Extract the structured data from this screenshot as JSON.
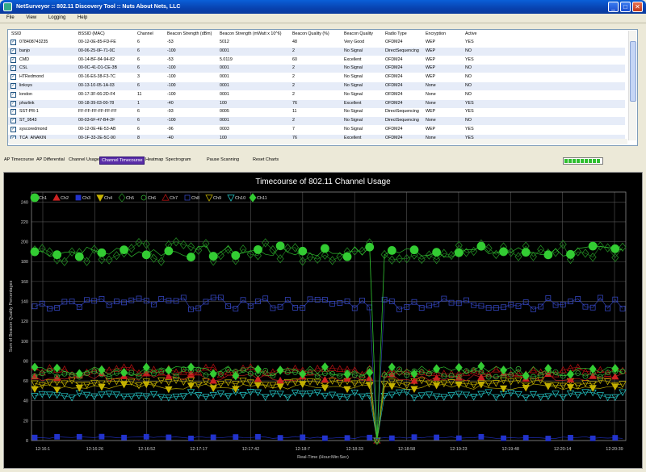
{
  "window": {
    "title": "NetSurveyor :: 802.11 Discovery Tool :: Nuts About Nets, LLC",
    "minimize": "_",
    "maximize": "□",
    "close": "✕"
  },
  "menu": [
    "File",
    "View",
    "Logging",
    "Help"
  ],
  "table": {
    "columns": [
      "SSID",
      "BSSID (MAC)",
      "Channel",
      "Beacon Strength (dBm)",
      "Beacon Strength (mWatt x 10^6)",
      "Beacon Quality (%)",
      "Beacon Quality",
      "Radio Type",
      "Encryption",
      "Active"
    ],
    "rows": [
      {
        "checked": true,
        "cells": [
          "078408743235",
          "00-12-0E-85-FD-FE",
          "6",
          "-53",
          "5012",
          "48",
          "Very Good",
          "OFDM24",
          "WEP",
          "YES"
        ]
      },
      {
        "checked": true,
        "cells": [
          "banjo",
          "00-06-25-0F-71-0C",
          "6",
          "-100",
          "0001",
          "2",
          "No Signal",
          "DirectSequencing",
          "WEP",
          "NO"
        ]
      },
      {
        "checked": true,
        "cells": [
          "CMD",
          "00-14-BF-84-94-82",
          "6",
          "-53",
          "5.0119",
          "60",
          "Excellent",
          "OFDM24",
          "WEP",
          "YES"
        ]
      },
      {
        "checked": true,
        "cells": [
          "CSL",
          "00-0C-41-D1-CE-3B",
          "6",
          "-100",
          "0001",
          "2",
          "No Signal",
          "OFDM24",
          "WEP",
          "NO"
        ]
      },
      {
        "checked": true,
        "cells": [
          "HTRedmond",
          "00-16-E6-38-F3-7C",
          "3",
          "-100",
          "0001",
          "2",
          "No Signal",
          "OFDM24",
          "WEP",
          "NO"
        ]
      },
      {
        "checked": true,
        "cells": [
          "linksys",
          "00-13-10-05-1A-03",
          "6",
          "-100",
          "0001",
          "2",
          "No Signal",
          "OFDM24",
          "None",
          "NO"
        ]
      },
      {
        "checked": true,
        "cells": [
          "london",
          "00-17-3F-66-2D-F4",
          "11",
          "-100",
          "0001",
          "2",
          "No Signal",
          "OFDM24",
          "None",
          "NO"
        ]
      },
      {
        "checked": true,
        "cells": [
          "pharlink",
          "00-18-39-03-00-78",
          "1",
          "-40",
          "100",
          "76",
          "Excellent",
          "OFDM24",
          "None",
          "YES"
        ]
      },
      {
        "checked": true,
        "cells": [
          "SST-PR-1",
          "FF-FF-FF-FF-FF-FF",
          "6",
          "-93",
          "0005",
          "11",
          "No Signal",
          "DirectSequencing",
          "WEP",
          "YES"
        ]
      },
      {
        "checked": true,
        "cells": [
          "ST_9543",
          "00-03-6F-47-B4-2F",
          "6",
          "-100",
          "0001",
          "2",
          "No Signal",
          "DirectSequencing",
          "None",
          "NO"
        ]
      },
      {
        "checked": true,
        "cells": [
          "syscoredmond",
          "00-12-0E-4E-53-AB",
          "6",
          "-96",
          "0003",
          "7",
          "No Signal",
          "OFDM24",
          "WEP",
          "YES"
        ]
      },
      {
        "checked": true,
        "cells": [
          "TCA_ANAKIN",
          "00-1F-33-2E-5C-90",
          "8",
          "-40",
          "100",
          "76",
          "Excellent",
          "OFDM24",
          "None",
          "YES"
        ]
      }
    ]
  },
  "tabs": [
    "AP Timecourse",
    "AP Differential",
    "Channel Usage",
    "Channel Timecourse",
    "Heatmap",
    "Spectrogram",
    "Pause Scanning",
    "Reset Charts"
  ],
  "active_tab": "Channel Timecourse",
  "scan_progress": 1.0,
  "chart_data": {
    "type": "line",
    "title": "Timecourse of 802.11 Channel Usage",
    "ylabel": "Sum of Beacon Quality Percentages",
    "xlabel": "Real-Time (Hour:Min:Sec)",
    "ylim": [
      0,
      250
    ],
    "yticks": [
      0,
      20,
      40,
      60,
      80,
      100,
      120,
      140,
      160,
      180,
      200,
      220,
      240
    ],
    "xticks": [
      "12:16:1",
      "12:16:26",
      "12:16:52",
      "12:17:17",
      "12:17:42",
      "12:18:7",
      "12:18:33",
      "12:18:58",
      "12:19:23",
      "12:19:48",
      "12:20:14",
      "12:20:39"
    ],
    "grid": true,
    "legend_position": "top-left",
    "background": "#000000",
    "series": [
      {
        "name": "Ch1",
        "color": "#33cc33",
        "marker": "circle",
        "base": 190,
        "noise": 6,
        "values": []
      },
      {
        "name": "Ch2",
        "color": "#cc2222",
        "marker": "triangle-up",
        "base": 64,
        "noise": 4,
        "values": []
      },
      {
        "name": "Ch3",
        "color": "#2233cc",
        "marker": "square",
        "base": 3,
        "noise": 1,
        "values": []
      },
      {
        "name": "Ch4",
        "color": "#c8b400",
        "marker": "triangle-down",
        "base": 54,
        "noise": 3,
        "values": []
      },
      {
        "name": "Ch5",
        "color": "#228822",
        "marker": "diamond-open",
        "base": 190,
        "noise": 10,
        "values": []
      },
      {
        "name": "Ch6",
        "color": "#33aa33",
        "marker": "circle-open",
        "base": 68,
        "noise": 4,
        "values": []
      },
      {
        "name": "Ch7",
        "color": "#aa1111",
        "marker": "triangle-up-open",
        "base": 70,
        "noise": 4,
        "values": []
      },
      {
        "name": "Ch8",
        "color": "#3344bb",
        "marker": "square-open",
        "base": 138,
        "noise": 6,
        "values": []
      },
      {
        "name": "Ch9",
        "color": "#bbaa00",
        "marker": "triangle-down-open",
        "base": 58,
        "noise": 3,
        "values": []
      },
      {
        "name": "Ch10",
        "color": "#22bbbb",
        "marker": "triangle-down-open",
        "base": 46,
        "noise": 3,
        "values": []
      },
      {
        "name": "Ch11",
        "color": "#33cc33",
        "marker": "diamond",
        "base": 70,
        "noise": 5,
        "values": []
      }
    ],
    "num_points": 80,
    "dip_index": 46
  }
}
